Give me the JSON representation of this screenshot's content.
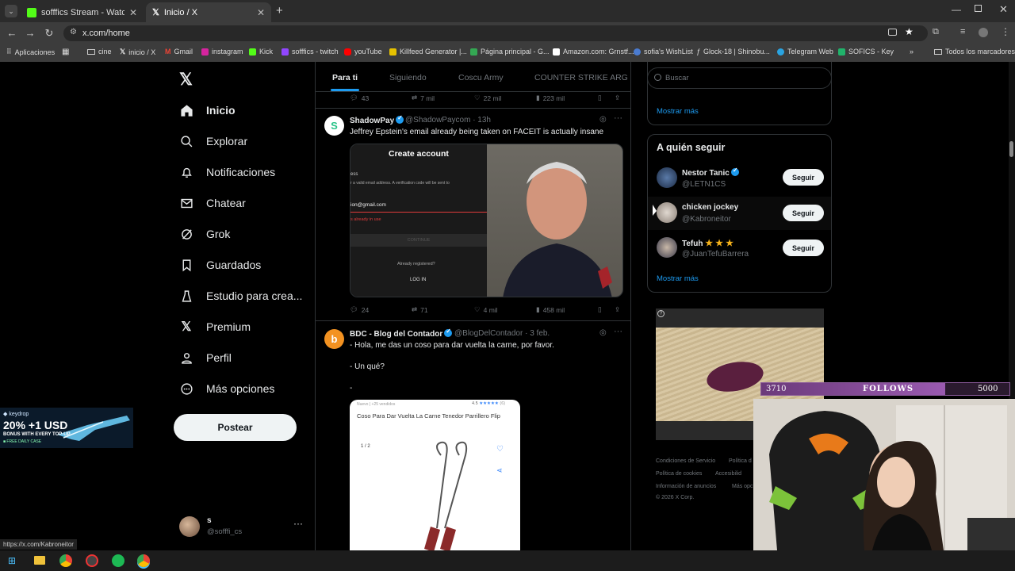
{
  "browser": {
    "tabs": [
      {
        "title": "sofffics Stream - Watch Live on",
        "active": false
      },
      {
        "title": "Inicio / X",
        "active": true
      }
    ],
    "url": "x.com/home",
    "bookmarks": [
      "Aplicaciones",
      "cine",
      "inicio / X",
      "Gmail",
      "instagram",
      "Kick",
      "sofffics - twitch",
      "youTube",
      "Killfeed Generator |...",
      "Página principal - G...",
      "Amazon.com: Grnstf...",
      "sofia's WishList",
      "Glock-18 | Shinobu...",
      "Telegram Web",
      "SOFICS - Key"
    ],
    "all_bookmarks": "Todos los marcadores"
  },
  "nav": {
    "items": [
      {
        "label": "Inicio",
        "icon": "home-icon"
      },
      {
        "label": "Explorar",
        "icon": "search-icon"
      },
      {
        "label": "Notificaciones",
        "icon": "bell-icon"
      },
      {
        "label": "Chatear",
        "icon": "mail-icon"
      },
      {
        "label": "Grok",
        "icon": "grok-icon"
      },
      {
        "label": "Guardados",
        "icon": "bookmark-icon"
      },
      {
        "label": "Estudio para crea...",
        "icon": "studio-icon"
      },
      {
        "label": "Premium",
        "icon": "x-logo-icon"
      },
      {
        "label": "Perfil",
        "icon": "person-icon"
      },
      {
        "label": "Más opciones",
        "icon": "more-circle-icon"
      }
    ],
    "post_label": "Postear",
    "account": {
      "name": "s",
      "handle": "@sofffi_cs"
    }
  },
  "feed": {
    "tabs": [
      "Para ti",
      "Siguiendo",
      "Coscu Army",
      "COUNTER STRIKE ARG"
    ],
    "top_actions": {
      "replies": "43",
      "reposts": "7 mil",
      "likes": "22 mil",
      "views": "223 mil"
    },
    "tweets": [
      {
        "name": "ShadowPay",
        "handle": "@ShadowPaycom · 13h",
        "text": "Jeffrey Epstein's email already being taken on FACEIT is actually insane",
        "media": {
          "title": "Create account",
          "line1": "ess",
          "line2": "r a valid email address. A verification code will be sent to",
          "email": "ion@gmail.com",
          "error": "s already in use",
          "continue": "CONTINUE",
          "registered": "Already registered?",
          "login": "LOG IN"
        },
        "actions": {
          "replies": "24",
          "reposts": "71",
          "likes": "4 mil",
          "views": "458 mil"
        }
      },
      {
        "name": "BDC - Blog del Contador",
        "handle": "@BlogDelContador · 3 feb.",
        "lines": [
          "- Hola, me das un coso para dar vuelta la carne, por favor.",
          "- Un qué?",
          "-"
        ],
        "media": {
          "tag": "Nuevo  |  +25 vendidos",
          "rating": "4.5",
          "count": "(6)",
          "title": "Coso Para Dar Vuelta La Carne Tenedor Parrillero Flip",
          "pager": "1 / 2"
        }
      }
    ]
  },
  "right": {
    "search_placeholder": "Buscar",
    "show_more": "Mostrar más",
    "who_to_follow": "A quién seguir",
    "follow_label": "Seguir",
    "suggestions": [
      {
        "name": "Nestor Tanic",
        "handle": "@LETN1CS",
        "verified": true
      },
      {
        "name": "chicken jockey",
        "handle": "@Kabroneitor",
        "verified": false
      },
      {
        "name": "Tefuh",
        "handle": "@JuanTefuBarrera",
        "verified": false
      }
    ],
    "footer": [
      "Condiciones de Servicio",
      "Política d",
      "Política de cookies",
      "Accesibilid",
      "Información de anuncios",
      "Más opc",
      "© 2026 X Corp."
    ]
  },
  "overlays": {
    "keydrop": {
      "brand": "keydrop",
      "headline": "20% +1 USD",
      "sub": "BONUS WITH EVERY TOP-UP",
      "tag": "FREE DAILY CASE"
    },
    "follows_bar": {
      "current": "3710",
      "label": "FOLLOWS",
      "goal": "5000",
      "progress": 0.742
    }
  },
  "status_url": "https://x.com/Kabroneitor",
  "colors": {
    "accent": "#1d9bf0",
    "bg": "#000000",
    "border": "#2f3336",
    "muted": "#71767b"
  }
}
